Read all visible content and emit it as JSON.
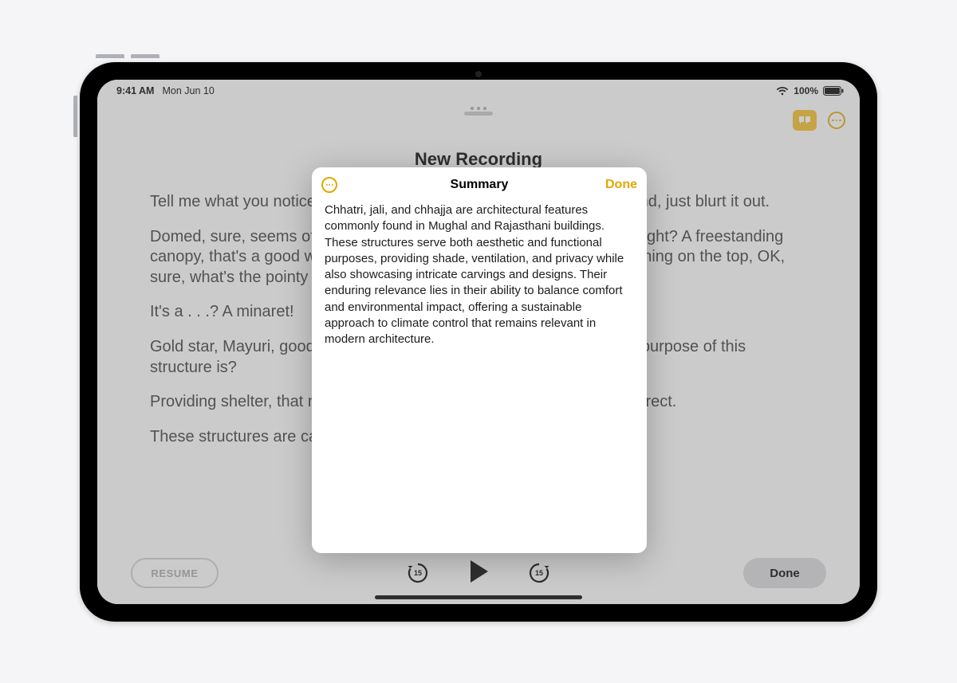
{
  "status": {
    "time": "9:41 AM",
    "date": "Mon Jun 10",
    "battery_percent": "100%"
  },
  "recording": {
    "title": "New Recording",
    "paragraphs": [
      "Tell me what you notice about this structure. No need to raise your hand, just blurt it out.",
      "Domed, sure, seems of a piece with everything else we've looked at, right? A freestanding canopy, that's a good way of putting it. A form of fine carvings. Pointy thing on the top, OK, sure, what's the pointy thing called?",
      "It's a . . .? A minaret!",
      "Gold star, Mayuri, good recall. And what, kids, would you imagine the purpose of this structure is?",
      "Providing shelter, that makes sense, right? Yes, you are absolutely correct.",
      "These structures are called chhatri."
    ]
  },
  "controls": {
    "resume_label": "RESUME",
    "skip_seconds": "15",
    "done_label": "Done"
  },
  "modal": {
    "title": "Summary",
    "done_label": "Done",
    "body": "Chhatri, jali, and chhajja are architectural features commonly found in Mughal and Rajasthani buildings. These structures serve both aesthetic and functional purposes, providing shade, ventilation, and privacy while also showcasing intricate carvings and designs. Their enduring relevance lies in their ability to balance comfort and environmental impact, offering a sustainable approach to climate control that remains relevant in modern architecture."
  },
  "colors": {
    "accent": "#e2a800"
  }
}
